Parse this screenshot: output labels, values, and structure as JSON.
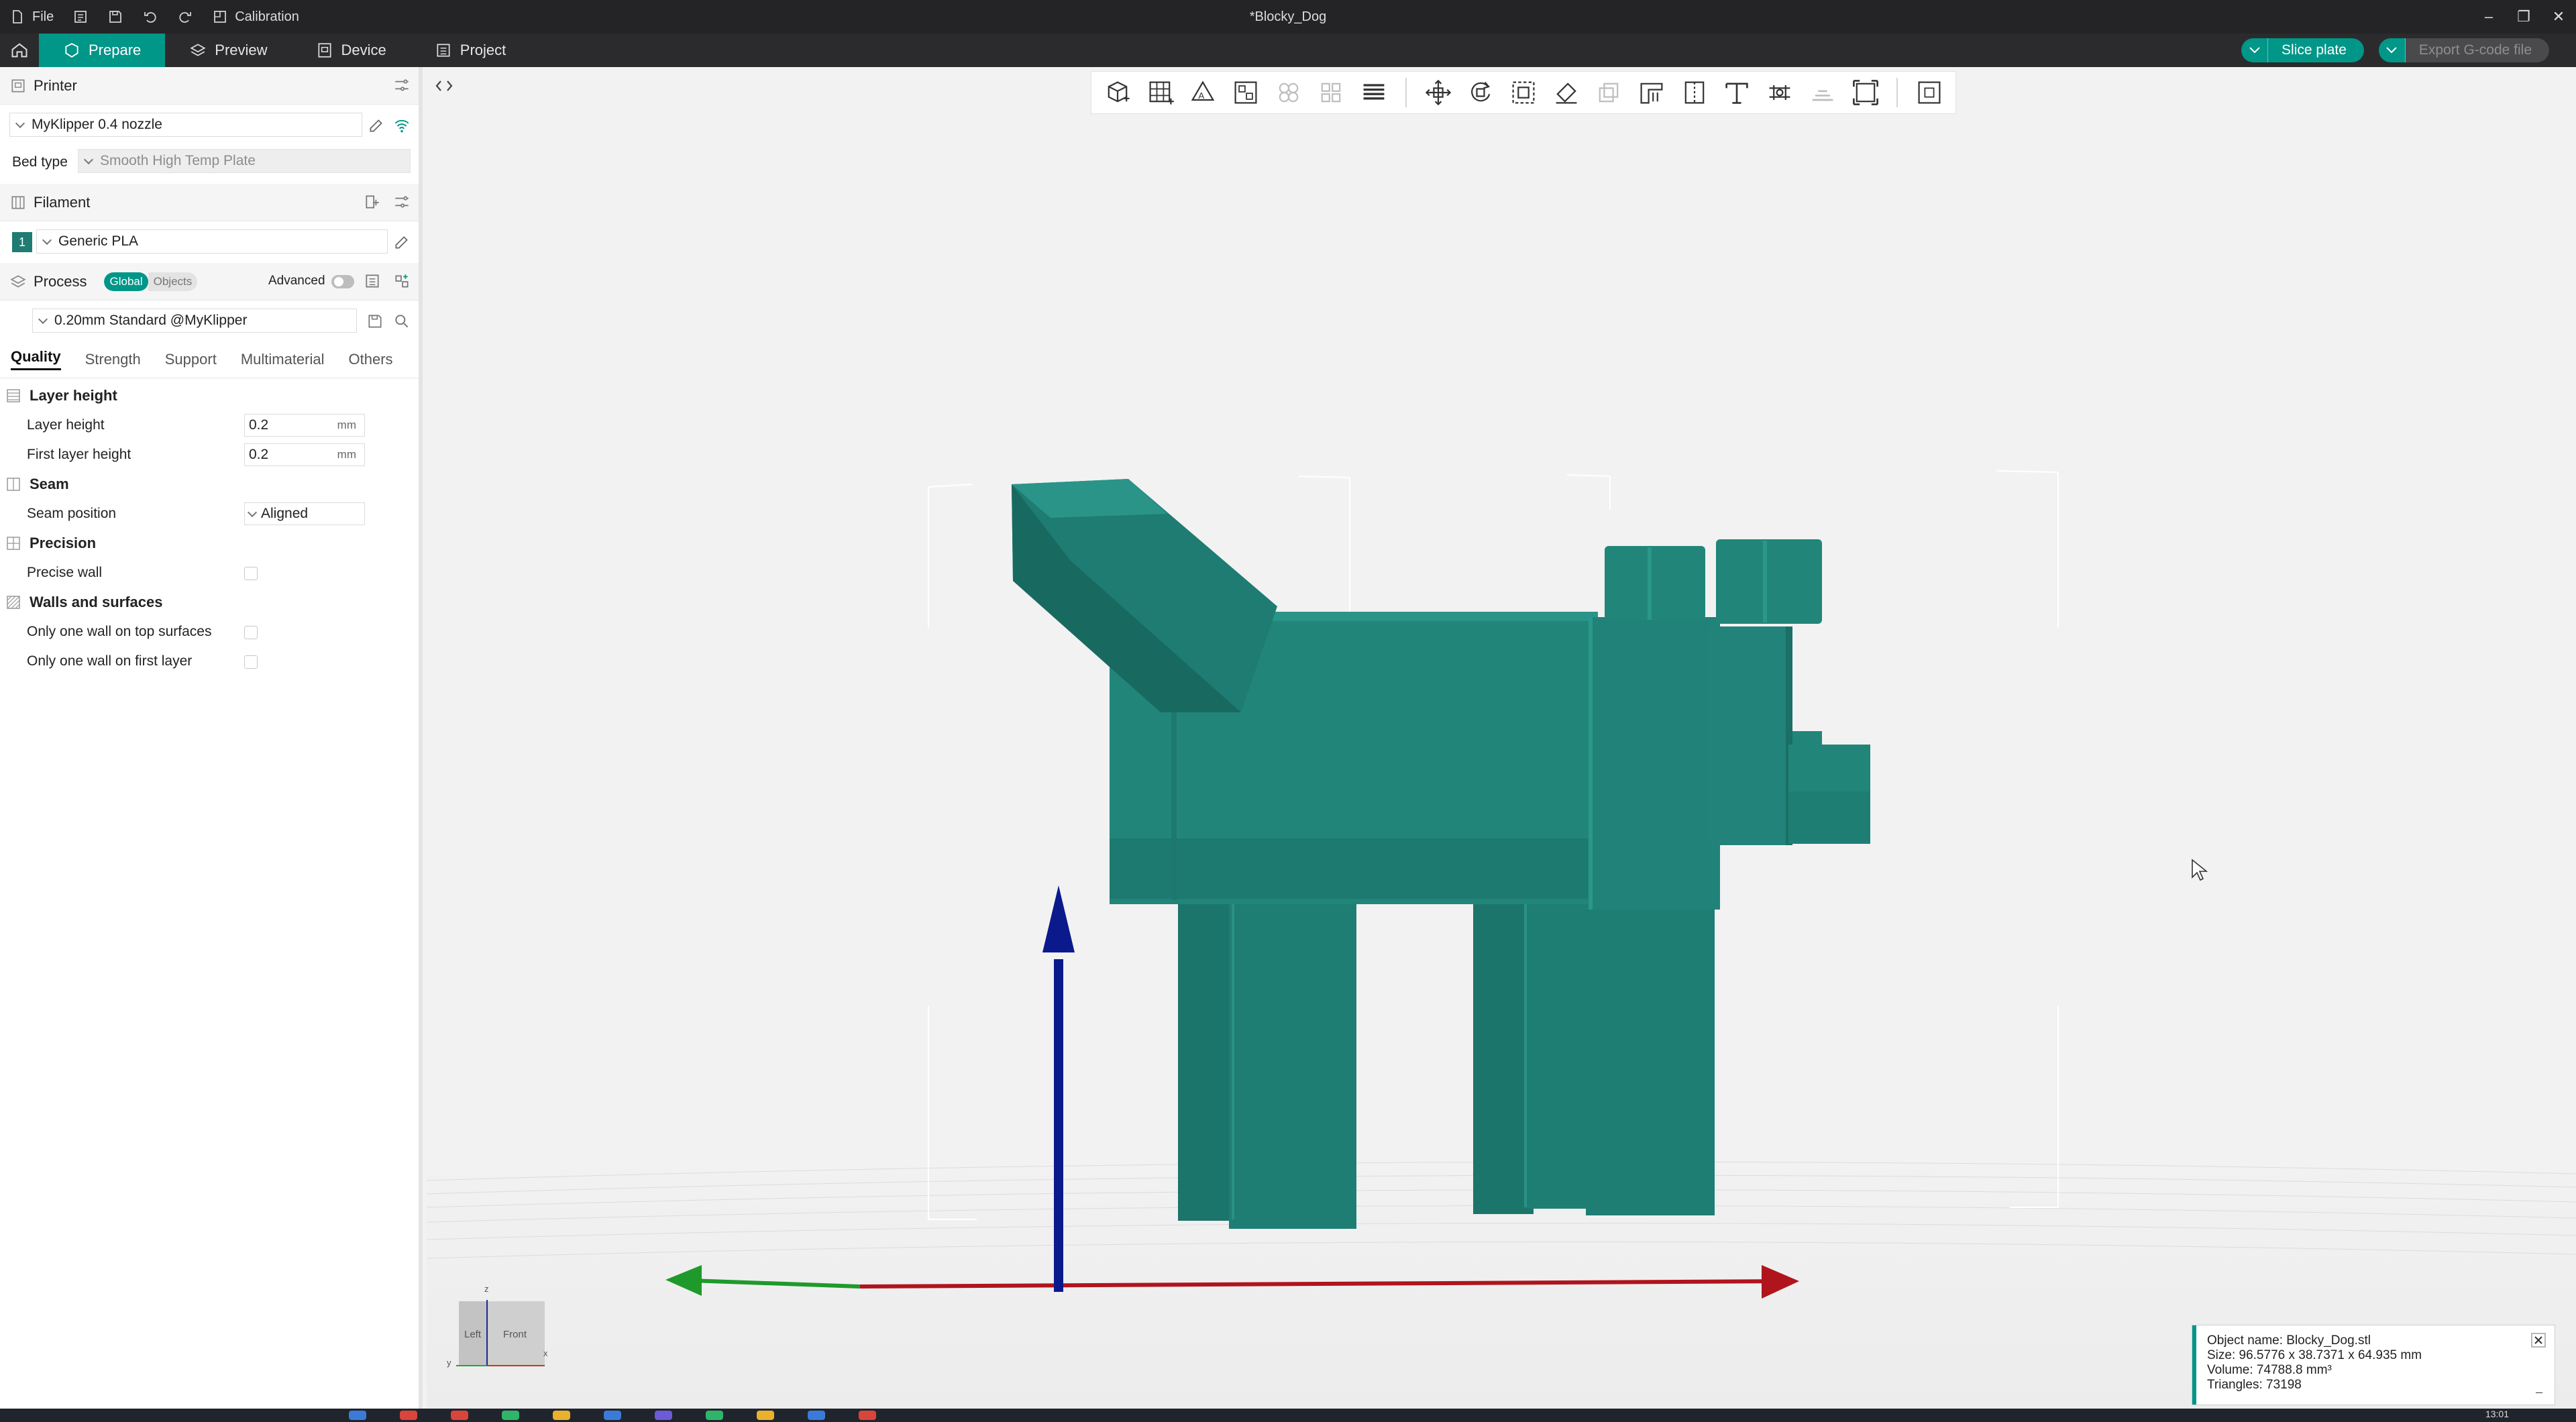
{
  "titlebar": {
    "file_label": "File",
    "calibration_label": "Calibration",
    "document_title": "*Blocky_Dog"
  },
  "topnav": {
    "tabs": [
      {
        "label": "Prepare"
      },
      {
        "label": "Preview"
      },
      {
        "label": "Device"
      },
      {
        "label": "Project"
      }
    ],
    "slice_label": "Slice plate",
    "export_label": "Export G-code file"
  },
  "sidebar": {
    "printer": {
      "section_label": "Printer",
      "printer_name": "MyKlipper 0.4 nozzle",
      "bed_type_label": "Bed type",
      "bed_type_value": "Smooth High Temp Plate"
    },
    "filament": {
      "section_label": "Filament",
      "slot_number": "1",
      "filament_name": "Generic PLA"
    },
    "process": {
      "section_label": "Process",
      "global_label": "Global",
      "objects_label": "Objects",
      "advanced_label": "Advanced",
      "preset_name": "0.20mm Standard @MyKlipper"
    },
    "tabs": [
      "Quality",
      "Strength",
      "Support",
      "Multimaterial",
      "Others"
    ],
    "groups": {
      "layer_height": {
        "title": "Layer height",
        "layer_height_label": "Layer height",
        "layer_height_value": "0.2",
        "first_layer_height_label": "First layer height",
        "first_layer_height_value": "0.2",
        "unit": "mm"
      },
      "seam": {
        "title": "Seam",
        "seam_position_label": "Seam position",
        "seam_position_value": "Aligned"
      },
      "precision": {
        "title": "Precision",
        "precise_wall_label": "Precise wall"
      },
      "walls": {
        "title": "Walls and surfaces",
        "one_wall_top_label": "Only one wall on top surfaces",
        "one_wall_first_label": "Only one wall on first layer"
      }
    }
  },
  "viewcube": {
    "left_label": "Left",
    "front_label": "Front",
    "z_label": "z",
    "y_label": "y",
    "x_label": "x"
  },
  "info": {
    "object_name": "Object name: Blocky_Dog.stl",
    "size": "Size: 96.5776 x 38.7371 x 64.935 mm",
    "volume": "Volume: 74788.8 mm³",
    "triangles": "Triangles: 73198"
  },
  "taskbar": {
    "clock": "13:01"
  },
  "colors": {
    "accent": "#009688",
    "model": "#1e7c72",
    "titlebar": "#242426",
    "axis_x": "#b0141c",
    "axis_y": "#1f9a2a",
    "axis_z": "#0a1a8c"
  }
}
